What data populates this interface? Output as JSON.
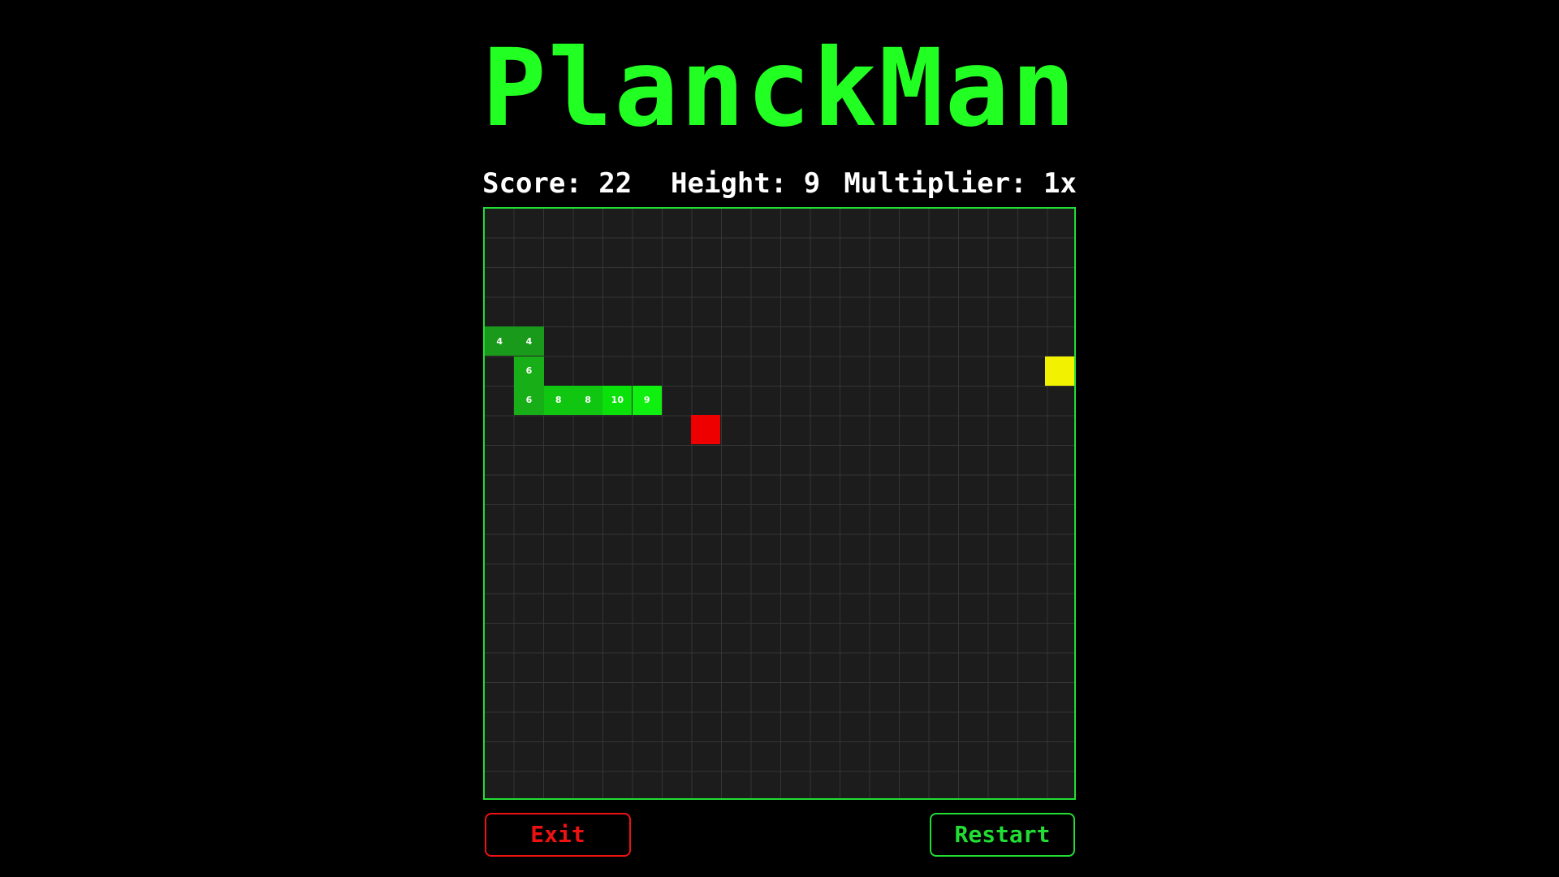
{
  "title": "PlanckMan",
  "stats": {
    "score_label": "Score: 22",
    "height_label": "Height: 9",
    "multiplier_label": "Multiplier: 1x"
  },
  "board": {
    "columns": 20,
    "rows": 20,
    "snake": [
      {
        "col": 0,
        "row": 4,
        "label": "4",
        "color": "#1a9a1a"
      },
      {
        "col": 1,
        "row": 4,
        "label": "4",
        "color": "#1a9a1a"
      },
      {
        "col": 1,
        "row": 5,
        "label": "6",
        "color": "#17ae17"
      },
      {
        "col": 1,
        "row": 6,
        "label": "6",
        "color": "#17ae17"
      },
      {
        "col": 2,
        "row": 6,
        "label": "8",
        "color": "#11c611"
      },
      {
        "col": 3,
        "row": 6,
        "label": "8",
        "color": "#11c611"
      },
      {
        "col": 4,
        "row": 6,
        "label": "10",
        "color": "#0ae00a"
      },
      {
        "col": 5,
        "row": 6,
        "label": "9",
        "color": "#10f010"
      }
    ],
    "food": {
      "col": 7,
      "row": 7,
      "color": "#ee0000"
    },
    "bonus": {
      "col": 19,
      "row": 5,
      "color": "#f2f200"
    }
  },
  "buttons": {
    "exit_label": "Exit",
    "restart_label": "Restart",
    "exit_color": "#ee1111",
    "restart_color": "#22dd33"
  }
}
